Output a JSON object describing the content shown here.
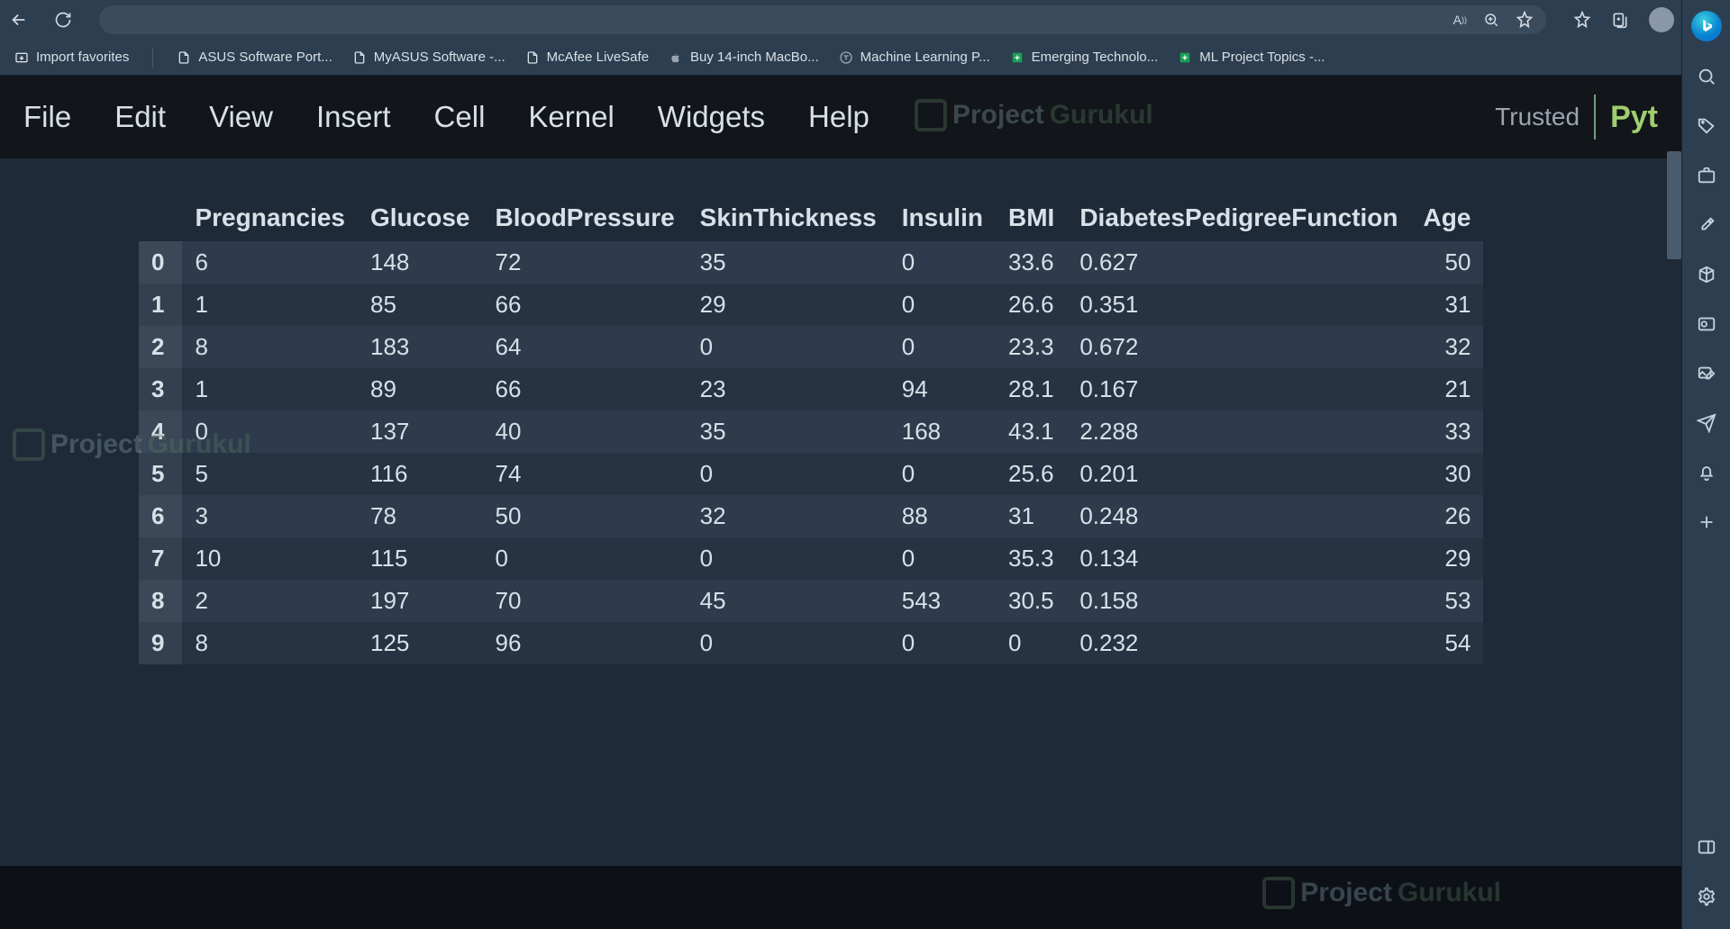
{
  "browser": {
    "bookmarks": {
      "import": "Import favorites",
      "items": [
        {
          "icon": "page",
          "label": "ASUS Software Port..."
        },
        {
          "icon": "page",
          "label": "MyASUS Software -..."
        },
        {
          "icon": "page",
          "label": "McAfee LiveSafe"
        },
        {
          "icon": "apple",
          "label": "Buy 14-inch MacBo..."
        },
        {
          "icon": "circle-t",
          "label": "Machine Learning P..."
        },
        {
          "icon": "sheet",
          "label": "Emerging Technolo..."
        },
        {
          "icon": "sheet",
          "label": "ML Project Topics -..."
        }
      ]
    }
  },
  "jupyter": {
    "menu": [
      "File",
      "Edit",
      "View",
      "Insert",
      "Cell",
      "Kernel",
      "Widgets",
      "Help"
    ],
    "trusted": "Trusted",
    "kernel": "Pyt"
  },
  "watermark": {
    "p1": "Project",
    "p2": "Gurukul"
  },
  "chart_data": {
    "type": "table",
    "columns": [
      "Pregnancies",
      "Glucose",
      "BloodPressure",
      "SkinThickness",
      "Insulin",
      "BMI",
      "DiabetesPedigreeFunction",
      "Age"
    ],
    "index": [
      0,
      1,
      2,
      3,
      4,
      5,
      6,
      7,
      8,
      9
    ],
    "rows": [
      [
        6,
        148,
        72,
        35,
        0,
        33.6,
        0.627,
        50
      ],
      [
        1,
        85,
        66,
        29,
        0,
        26.6,
        0.351,
        31
      ],
      [
        8,
        183,
        64,
        0,
        0,
        23.3,
        0.672,
        32
      ],
      [
        1,
        89,
        66,
        23,
        94,
        28.1,
        0.167,
        21
      ],
      [
        0,
        137,
        40,
        35,
        168,
        43.1,
        2.288,
        33
      ],
      [
        5,
        116,
        74,
        0,
        0,
        25.6,
        0.201,
        30
      ],
      [
        3,
        78,
        50,
        32,
        88,
        31.0,
        0.248,
        26
      ],
      [
        10,
        115,
        0,
        0,
        0,
        35.3,
        0.134,
        29
      ],
      [
        2,
        197,
        70,
        45,
        543,
        30.5,
        0.158,
        53
      ],
      [
        8,
        125,
        96,
        0,
        0,
        0.0,
        0.232,
        54
      ]
    ]
  }
}
